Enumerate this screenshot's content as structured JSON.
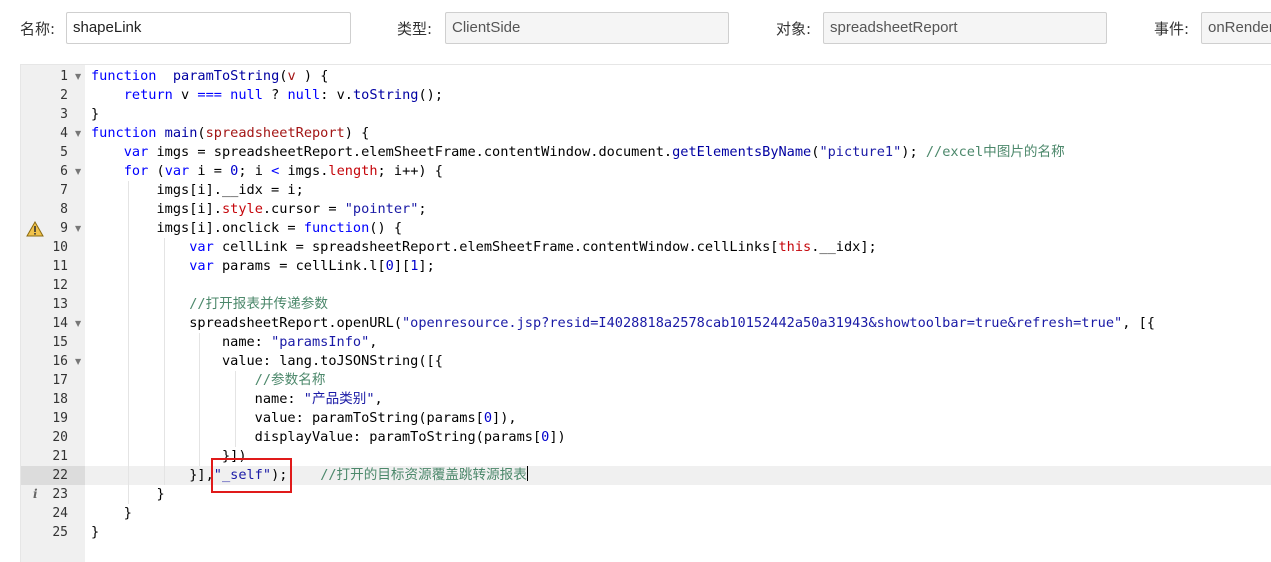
{
  "form": {
    "name": {
      "label": "名称:",
      "value": "shapeLink"
    },
    "type": {
      "label": "类型:",
      "value": "ClientSide"
    },
    "object": {
      "label": "对象:",
      "value": "spreadsheetReport"
    },
    "event": {
      "label": "事件:",
      "value": "onRender"
    }
  },
  "editor": {
    "active_line": 22,
    "lines": [
      {
        "n": "1",
        "fold": true,
        "indent": 0,
        "tokens": [
          [
            "kw",
            "function"
          ],
          [
            "",
            "  "
          ],
          [
            "fn",
            "paramToString"
          ],
          [
            "",
            "("
          ],
          [
            "prm",
            "v"
          ],
          [
            "",
            " ) {"
          ]
        ]
      },
      {
        "n": "2",
        "indent": 1,
        "tokens": [
          [
            "",
            "    "
          ],
          [
            "kw",
            "return"
          ],
          [
            "",
            " v "
          ],
          [
            "kw",
            "==="
          ],
          [
            "",
            " "
          ],
          [
            "kw",
            "null"
          ],
          [
            "",
            " ? "
          ],
          [
            "kw",
            "null"
          ],
          [
            "",
            ": v."
          ],
          [
            "bi",
            "toString"
          ],
          [
            "",
            "();"
          ]
        ]
      },
      {
        "n": "3",
        "indent": 0,
        "tokens": [
          [
            "",
            "}"
          ]
        ]
      },
      {
        "n": "4",
        "fold": true,
        "indent": 0,
        "tokens": [
          [
            "kw",
            "function"
          ],
          [
            "",
            " "
          ],
          [
            "fn",
            "main"
          ],
          [
            "",
            "("
          ],
          [
            "prm",
            "spreadsheetReport"
          ],
          [
            "",
            ") {"
          ]
        ]
      },
      {
        "n": "5",
        "indent": 1,
        "tokens": [
          [
            "",
            "    "
          ],
          [
            "kw",
            "var"
          ],
          [
            "",
            " imgs = spreadsheetReport.elemSheetFrame.contentWindow.document."
          ],
          [
            "bi",
            "getElementsByName"
          ],
          [
            "",
            "("
          ],
          [
            "str",
            "\"picture1\""
          ],
          [
            "",
            "); "
          ],
          [
            "cm",
            "//excel中图片的名称"
          ]
        ]
      },
      {
        "n": "6",
        "fold": true,
        "indent": 1,
        "tokens": [
          [
            "",
            "    "
          ],
          [
            "kw",
            "for"
          ],
          [
            "",
            " ("
          ],
          [
            "kw",
            "var"
          ],
          [
            "",
            " i = "
          ],
          [
            "num",
            "0"
          ],
          [
            "",
            "; i "
          ],
          [
            "kw",
            "<"
          ],
          [
            "",
            " imgs."
          ],
          [
            "prop",
            "length"
          ],
          [
            "",
            "; i++) {"
          ]
        ]
      },
      {
        "n": "7",
        "indent": 2,
        "tokens": [
          [
            "",
            "        imgs[i].__idx = i;"
          ]
        ]
      },
      {
        "n": "8",
        "indent": 2,
        "tokens": [
          [
            "",
            "        imgs[i]."
          ],
          [
            "prop",
            "style"
          ],
          [
            "",
            ".cursor = "
          ],
          [
            "str",
            "\"pointer\""
          ],
          [
            "",
            ";"
          ]
        ]
      },
      {
        "n": "9",
        "fold": true,
        "warn": true,
        "indent": 2,
        "tokens": [
          [
            "",
            "        imgs[i].onclick = "
          ],
          [
            "kw",
            "function"
          ],
          [
            "",
            "() {"
          ]
        ]
      },
      {
        "n": "10",
        "indent": 3,
        "tokens": [
          [
            "",
            "            "
          ],
          [
            "kw",
            "var"
          ],
          [
            "",
            " cellLink = spreadsheetReport.elemSheetFrame.contentWindow.cellLinks["
          ],
          [
            "prop",
            "this"
          ],
          [
            "",
            ".__idx];"
          ]
        ]
      },
      {
        "n": "11",
        "indent": 3,
        "tokens": [
          [
            "",
            "            "
          ],
          [
            "kw",
            "var"
          ],
          [
            "",
            " params = cellLink.l["
          ],
          [
            "num",
            "0"
          ],
          [
            "",
            "]["
          ],
          [
            "num",
            "1"
          ],
          [
            "",
            "];"
          ]
        ]
      },
      {
        "n": "12",
        "indent": 3,
        "tokens": [
          [
            "",
            ""
          ]
        ]
      },
      {
        "n": "13",
        "indent": 3,
        "tokens": [
          [
            "",
            "            "
          ],
          [
            "cm",
            "//打开报表并传递参数"
          ]
        ]
      },
      {
        "n": "14",
        "fold": true,
        "indent": 3,
        "tokens": [
          [
            "",
            "            spreadsheetReport.openURL("
          ],
          [
            "str",
            "\"openresource.jsp?resid=I4028818a2578cab10152442a50a31943&showtoolbar=true&refresh=true\""
          ],
          [
            "",
            ", [{"
          ]
        ]
      },
      {
        "n": "15",
        "indent": 4,
        "tokens": [
          [
            "",
            "                name: "
          ],
          [
            "str",
            "\"paramsInfo\""
          ],
          [
            "",
            ","
          ]
        ]
      },
      {
        "n": "16",
        "fold": true,
        "indent": 4,
        "tokens": [
          [
            "",
            "                value: lang.toJSONString([{"
          ]
        ]
      },
      {
        "n": "17",
        "indent": 5,
        "tokens": [
          [
            "",
            "                    "
          ],
          [
            "cm",
            "//参数名称"
          ]
        ]
      },
      {
        "n": "18",
        "indent": 5,
        "tokens": [
          [
            "",
            "                    name: "
          ],
          [
            "str",
            "\"产品类别\""
          ],
          [
            "",
            ","
          ]
        ]
      },
      {
        "n": "19",
        "indent": 5,
        "tokens": [
          [
            "",
            "                    value: paramToString(params["
          ],
          [
            "num",
            "0"
          ],
          [
            "",
            "]),"
          ]
        ]
      },
      {
        "n": "20",
        "indent": 5,
        "tokens": [
          [
            "",
            "                    displayValue: paramToString(params["
          ],
          [
            "num",
            "0"
          ],
          [
            "",
            "])"
          ]
        ]
      },
      {
        "n": "21",
        "indent": 4,
        "tokens": [
          [
            "",
            "                }])"
          ]
        ]
      },
      {
        "n": "22",
        "indent": 3,
        "cursor": true,
        "tokens": [
          [
            "",
            "            }],"
          ],
          [
            "str",
            "\"_self\""
          ],
          [
            "",
            "); "
          ],
          [
            "",
            "   "
          ],
          [
            "cm",
            "//打开的目标资源覆盖跳转源报表"
          ]
        ]
      },
      {
        "n": "23",
        "info": true,
        "indent": 2,
        "tokens": [
          [
            "",
            "        }"
          ]
        ]
      },
      {
        "n": "24",
        "indent": 1,
        "tokens": [
          [
            "",
            "    }"
          ]
        ]
      },
      {
        "n": "25",
        "indent": 0,
        "tokens": [
          [
            "",
            "}"
          ]
        ]
      }
    ]
  },
  "colors": {
    "highlight_box": "#e01a1a",
    "gutter": "#f0f0f0",
    "active_line": "#f0f0f0"
  }
}
